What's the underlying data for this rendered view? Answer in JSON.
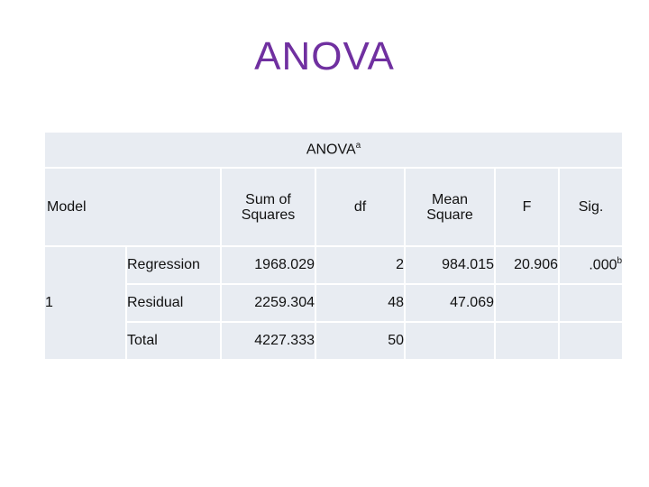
{
  "slide": {
    "title": "ANOVA"
  },
  "table": {
    "caption": "ANOVA",
    "caption_footnote": "a",
    "headers": {
      "model": "Model",
      "sum_of_squares": "Sum of Squares",
      "df": "df",
      "mean_square": "Mean Square",
      "f": "F",
      "sig": "Sig."
    },
    "model_number": "1",
    "rows": [
      {
        "label": "Regression",
        "sum_of_squares": "1968.029",
        "df": "2",
        "mean_square": "984.015",
        "f": "20.906",
        "sig": ".000",
        "sig_footnote": "b"
      },
      {
        "label": "Residual",
        "sum_of_squares": "2259.304",
        "df": "48",
        "mean_square": "47.069",
        "f": "",
        "sig": ""
      },
      {
        "label": "Total",
        "sum_of_squares": "4227.333",
        "df": "50",
        "mean_square": "",
        "f": "",
        "sig": ""
      }
    ]
  },
  "colors": {
    "title": "#7030a0",
    "cell_background": "#e8ecf2",
    "grid": "#ffffff"
  }
}
